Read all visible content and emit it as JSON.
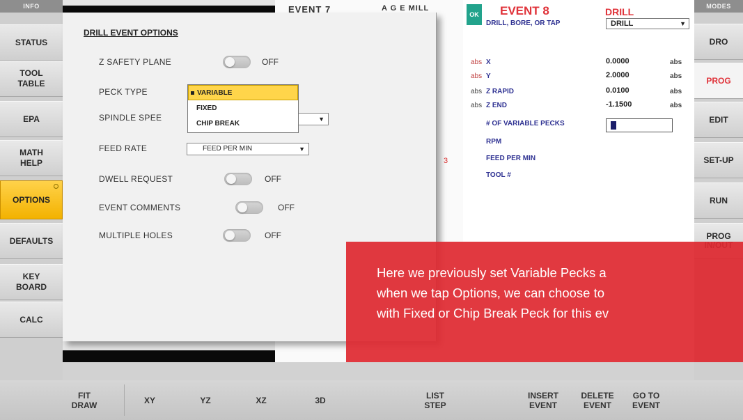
{
  "left_panel": {
    "header": "INFO",
    "buttons": [
      {
        "label": "STATUS"
      },
      {
        "label": "TOOL\nTABLE"
      },
      {
        "label": "EPA"
      },
      {
        "label": "MATH\nHELP"
      },
      {
        "label": "OPTIONS"
      },
      {
        "label": "DEFAULTS"
      },
      {
        "label": "KEY\nBOARD"
      },
      {
        "label": "CALC"
      }
    ]
  },
  "right_panel": {
    "header": "MODES",
    "buttons": [
      {
        "label": "DRO"
      },
      {
        "label": "PROG"
      },
      {
        "label": "EDIT"
      },
      {
        "label": "SET-UP"
      },
      {
        "label": "RUN"
      },
      {
        "label": "PROG\nIN/OUT"
      }
    ]
  },
  "background": {
    "event7": "EVENT 7",
    "mill": "A G E MILL",
    "red_fragment": "3"
  },
  "options_dialog": {
    "title": "DRILL EVENT OPTIONS",
    "z_safety_plane": {
      "label": "Z SAFETY PLANE",
      "state": "OFF"
    },
    "peck_type": {
      "label": "PECK TYPE",
      "options": [
        "VARIABLE",
        "FIXED",
        "CHIP BREAK"
      ],
      "selected": "VARIABLE"
    },
    "spindle_speed": {
      "label": "SPINDLE SPEE"
    },
    "feed_rate": {
      "label": "FEED RATE",
      "value": "FEED PER MIN"
    },
    "dwell_request": {
      "label": "DWELL REQUEST",
      "state": "OFF"
    },
    "event_comments": {
      "label": "EVENT COMMENTS",
      "state": "OFF"
    },
    "multiple_holes": {
      "label": "MULTIPLE HOLES",
      "state": "OFF"
    }
  },
  "event_panel": {
    "ok": "OK",
    "title": "EVENT 8",
    "type": "DRILL",
    "op_label": "DRILL, BORE, OR TAP",
    "op_value": "DRILL",
    "abs": "abs",
    "x": {
      "label": "X",
      "value": "0.0000"
    },
    "y": {
      "label": "Y",
      "value": "2.0000"
    },
    "z_rapid": {
      "label": "Z RAPID",
      "value": "0.0100"
    },
    "z_end": {
      "label": "Z END",
      "value": "-1.1500"
    },
    "pecks_label": "# OF VARIABLE PECKS",
    "rpm_label": "RPM",
    "feed_label": "FEED PER MIN",
    "tool_label": "TOOL #"
  },
  "bottom_bar": {
    "buttons": [
      {
        "label": "FIT\nDRAW"
      },
      {
        "label": "XY"
      },
      {
        "label": "YZ"
      },
      {
        "label": "XZ"
      },
      {
        "label": "3D"
      },
      {
        "label": "LIST\nSTEP"
      },
      {
        "label": "INSERT\nEVENT"
      },
      {
        "label": "DELETE\nEVENT"
      },
      {
        "label": "GO TO\nEVENT"
      }
    ]
  },
  "callout": {
    "line1": "Here we previously set Variable Pecks a",
    "line2": "when we tap Options, we can choose to",
    "line3": "with Fixed or Chip Break Peck for this ev"
  },
  "colors": {
    "accent_red": "#e0333a",
    "highlight_yellow": "#f3b200",
    "label_blue": "#2e3192",
    "ok_green": "#22a38c",
    "callout_red": "#de2830"
  }
}
